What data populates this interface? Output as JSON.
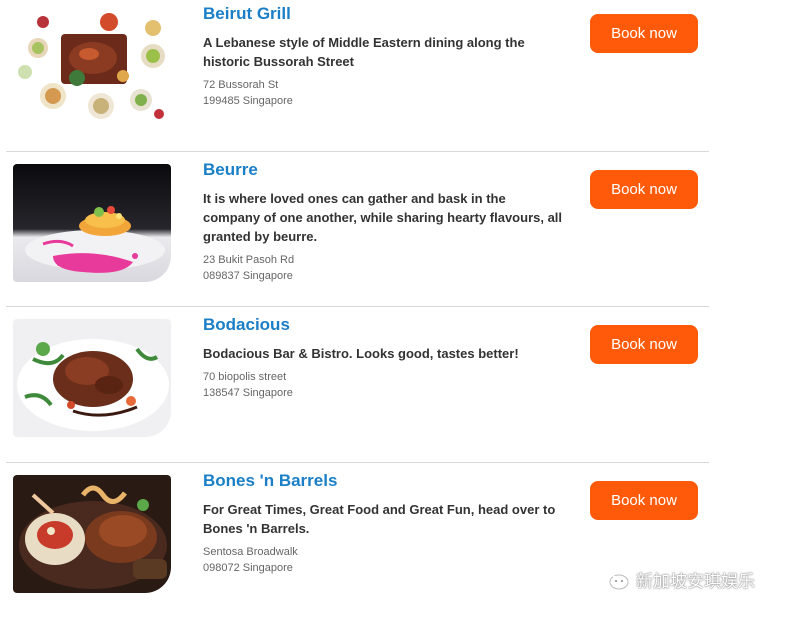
{
  "restaurants": [
    {
      "name": "Beirut Grill",
      "description": "A Lebanese style of Middle Eastern dining along the historic Bussorah Street",
      "address_line1": "72 Bussorah St",
      "address_line2": "199485 Singapore",
      "button": "Book now"
    },
    {
      "name": "Beurre",
      "description": "It is where loved ones can gather and bask in the company of one another, while sharing hearty flavours, all granted by beurre.",
      "address_line1": "23 Bukit Pasoh Rd",
      "address_line2": "089837 Singapore",
      "button": "Book now"
    },
    {
      "name": "Bodacious",
      "description": "Bodacious Bar & Bistro. Looks good, tastes better!",
      "address_line1": "70 biopolis street",
      "address_line2": "138547 Singapore",
      "button": "Book now"
    },
    {
      "name": "Bones 'n Barrels",
      "description": "For Great Times, Great Food and Great Fun, head over to Bones 'n Barrels.",
      "address_line1": "Sentosa Broadwalk",
      "address_line2": "098072 Singapore",
      "button": "Book now"
    }
  ],
  "watermark": "新加坡安琪娱乐",
  "colors": {
    "name_link": "#1a7fc6",
    "button_bg": "#ff5a0a",
    "text_dark": "#333333",
    "text_muted": "#666666"
  },
  "icons": {
    "watermark": "wechat-icon"
  }
}
